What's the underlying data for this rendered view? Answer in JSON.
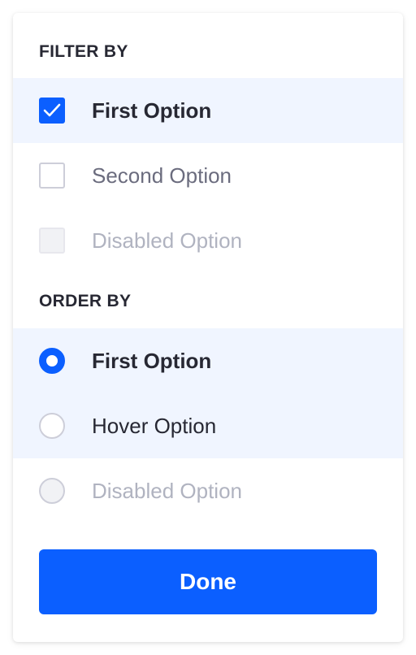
{
  "filter": {
    "header": "FILTER BY",
    "options": [
      {
        "label": "First Option",
        "state": "checked"
      },
      {
        "label": "Second Option",
        "state": "unchecked"
      },
      {
        "label": "Disabled Option",
        "state": "disabled"
      }
    ]
  },
  "order": {
    "header": "ORDER BY",
    "options": [
      {
        "label": "First Option",
        "state": "selected"
      },
      {
        "label": "Hover Option",
        "state": "hover"
      },
      {
        "label": "Disabled Option",
        "state": "disabled"
      }
    ]
  },
  "done_button": {
    "label": "Done"
  },
  "colors": {
    "primary": "#0b5fff",
    "highlight": "#f0f5ff",
    "text_dark": "#272833",
    "text_secondary": "#6b6c7e",
    "text_disabled": "#b0b3c0"
  },
  "icons": {
    "checkbox_checked": "checkmark-icon"
  }
}
